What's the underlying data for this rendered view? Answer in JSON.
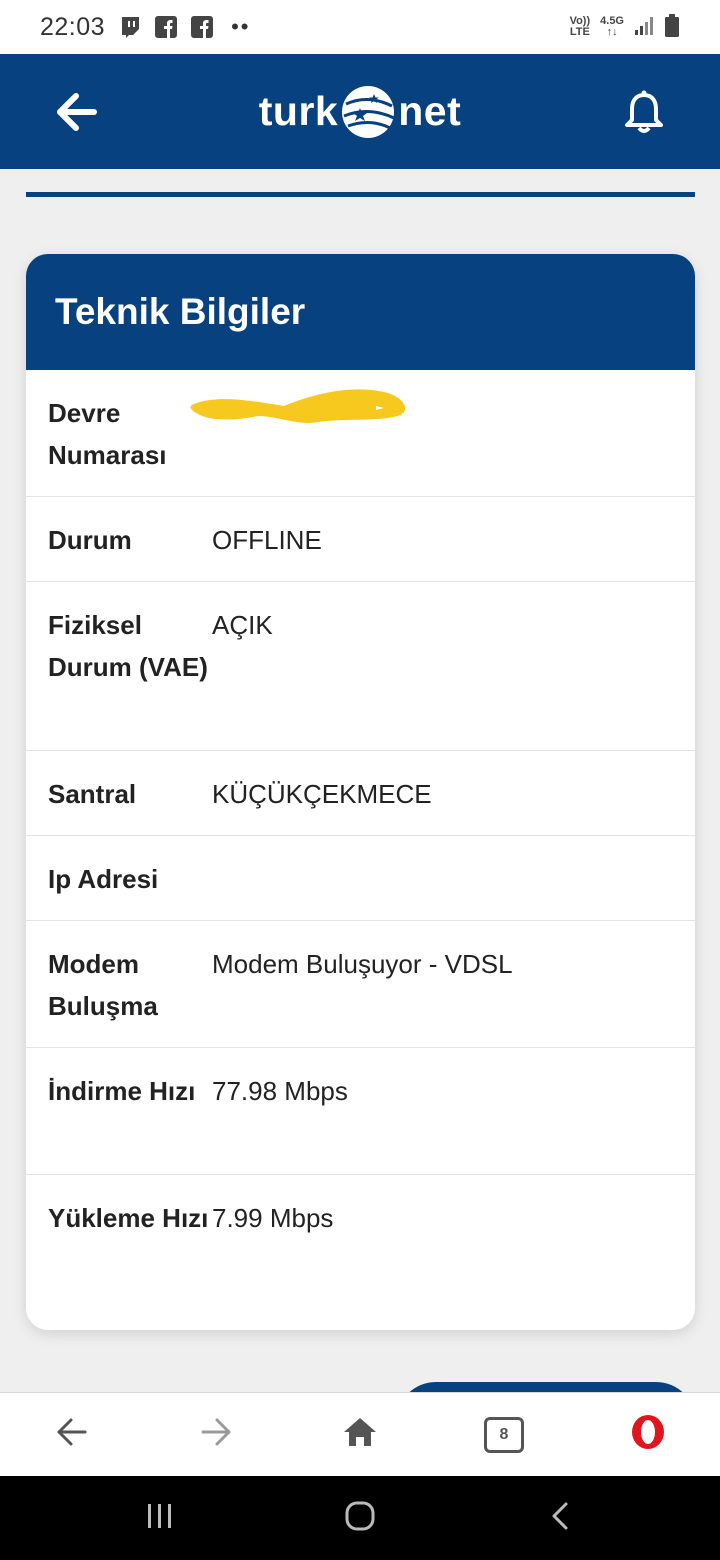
{
  "status_bar": {
    "time": "22:03",
    "dots": "••",
    "volte_top": "Vo))",
    "volte_bottom": "LTE",
    "net_top": "4.5G",
    "net_bottom": "↑↓"
  },
  "header": {
    "logo_left": "turk",
    "logo_right": "net",
    "back_icon": "arrow-left-icon",
    "bell_icon": "bell-icon"
  },
  "card": {
    "title": "Teknik Bilgiler",
    "rows": [
      {
        "label": "Devre Numarası",
        "value": ""
      },
      {
        "label": "Durum",
        "value": "OFFLINE"
      },
      {
        "label": "Fiziksel Durum (VAE)",
        "value": "AÇIK"
      },
      {
        "label": "Santral",
        "value": "KÜÇÜKÇEKMECE"
      },
      {
        "label": "Ip Adresi",
        "value": ""
      },
      {
        "label": "Modem Buluşma",
        "value": "Modem Buluşuyor - VDSL"
      },
      {
        "label": "İndirme Hızı",
        "value": "77.98 Mbps"
      },
      {
        "label": "Yükleme Hızı",
        "value": "7.99 Mbps"
      }
    ]
  },
  "browser_bar": {
    "tab_count": "8"
  },
  "colors": {
    "brand_blue": "#07417f",
    "redaction_yellow": "#f7c81e",
    "opera_red": "#e0151d"
  }
}
